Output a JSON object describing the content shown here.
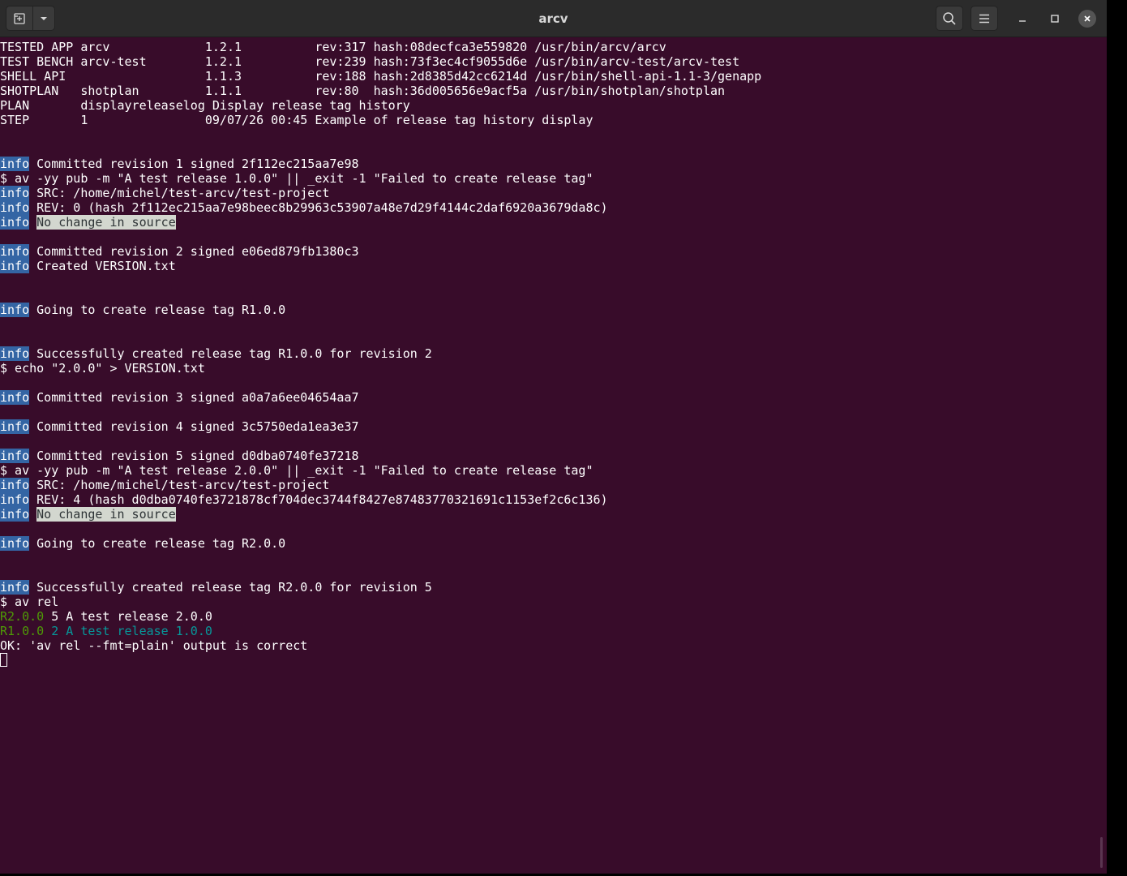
{
  "window": {
    "title": "arcv",
    "icons": {
      "new_tab": "new-tab-icon",
      "dropdown": "chevron-down-icon",
      "search": "search-icon",
      "menu": "hamburger-menu-icon",
      "minimize": "minimize-icon",
      "maximize": "maximize-icon",
      "close": "close-icon"
    }
  },
  "colors": {
    "terminal_bg": "#380c2a",
    "info_tag_bg": "#3465a4",
    "highlight_bg": "#d3d7cf",
    "green": "#4e9a06",
    "cyan": "#06989a",
    "titlebar_bg": "#2b2b2b"
  },
  "terminal": {
    "lines": [
      [
        {
          "t": "TESTED APP arcv             1.2.1          rev:317 hash:08decfca3e559820 /usr/bin/arcv/arcv"
        }
      ],
      [
        {
          "t": "TEST BENCH arcv-test        1.2.1          rev:239 hash:73f3ec4cf9055d6e /usr/bin/arcv-test/arcv-test"
        }
      ],
      [
        {
          "t": "SHELL API                   1.1.3          rev:188 hash:2d8385d42cc6214d /usr/bin/shell-api-1.1-3/genapp"
        }
      ],
      [
        {
          "t": "SHOTPLAN   shotplan         1.1.1          rev:80  hash:36d005656e9acf5a /usr/bin/shotplan/shotplan"
        }
      ],
      [
        {
          "t": "PLAN       displayreleaselog Display release tag history"
        }
      ],
      [
        {
          "t": "STEP       1                09/07/26 00:45 Example of release tag history display"
        }
      ],
      [],
      [],
      [
        {
          "t": "info",
          "c": "info"
        },
        {
          "t": " Committed revision 1 signed 2f112ec215aa7e98"
        }
      ],
      [
        {
          "t": "$ av -yy pub -m \"A test release 1.0.0\" || _exit -1 \"Failed to create release tag\""
        }
      ],
      [
        {
          "t": "info",
          "c": "info"
        },
        {
          "t": " SRC: /home/michel/test-arcv/test-project"
        }
      ],
      [
        {
          "t": "info",
          "c": "info"
        },
        {
          "t": " REV: 0 (hash 2f112ec215aa7e98beec8b29963c53907a48e7d29f4144c2daf6920a3679da8c)"
        }
      ],
      [
        {
          "t": "info",
          "c": "info"
        },
        {
          "t": " "
        },
        {
          "t": "No change in source",
          "c": "hl"
        }
      ],
      [],
      [
        {
          "t": "info",
          "c": "info"
        },
        {
          "t": " Committed revision 2 signed e06ed879fb1380c3"
        }
      ],
      [
        {
          "t": "info",
          "c": "info"
        },
        {
          "t": " Created VERSION.txt"
        }
      ],
      [],
      [],
      [
        {
          "t": "info",
          "c": "info"
        },
        {
          "t": " Going to create release tag R1.0.0"
        }
      ],
      [],
      [],
      [
        {
          "t": "info",
          "c": "info"
        },
        {
          "t": " Successfully created release tag R1.0.0 for revision 2"
        }
      ],
      [
        {
          "t": "$ echo \"2.0.0\" > VERSION.txt"
        }
      ],
      [],
      [
        {
          "t": "info",
          "c": "info"
        },
        {
          "t": " Committed revision 3 signed a0a7a6ee04654aa7"
        }
      ],
      [],
      [
        {
          "t": "info",
          "c": "info"
        },
        {
          "t": " Committed revision 4 signed 3c5750eda1ea3e37"
        }
      ],
      [],
      [
        {
          "t": "info",
          "c": "info"
        },
        {
          "t": " Committed revision 5 signed d0dba0740fe37218"
        }
      ],
      [
        {
          "t": "$ av -yy pub -m \"A test release 2.0.0\" || _exit -1 \"Failed to create release tag\""
        }
      ],
      [
        {
          "t": "info",
          "c": "info"
        },
        {
          "t": " SRC: /home/michel/test-arcv/test-project"
        }
      ],
      [
        {
          "t": "info",
          "c": "info"
        },
        {
          "t": " REV: 4 (hash d0dba0740fe3721878cf704dec3744f8427e87483770321691c1153ef2c6c136)"
        }
      ],
      [
        {
          "t": "info",
          "c": "info"
        },
        {
          "t": " "
        },
        {
          "t": "No change in source",
          "c": "hl"
        }
      ],
      [],
      [
        {
          "t": "info",
          "c": "info"
        },
        {
          "t": " Going to create release tag R2.0.0"
        }
      ],
      [],
      [],
      [
        {
          "t": "info",
          "c": "info"
        },
        {
          "t": " Successfully created release tag R2.0.0 for revision 5"
        }
      ],
      [
        {
          "t": "$ av rel"
        }
      ],
      [
        {
          "t": "R2.0.0",
          "c": "green"
        },
        {
          "t": " 5 A test release 2.0.0"
        }
      ],
      [
        {
          "t": "R1.0.0",
          "c": "green"
        },
        {
          "t": " 2 A test release 1.0.0",
          "c": "cyan"
        }
      ],
      [
        {
          "t": "OK: 'av rel --fmt=plain' output is correct"
        }
      ],
      [
        {
          "t": "",
          "c": "cursor"
        }
      ]
    ]
  }
}
